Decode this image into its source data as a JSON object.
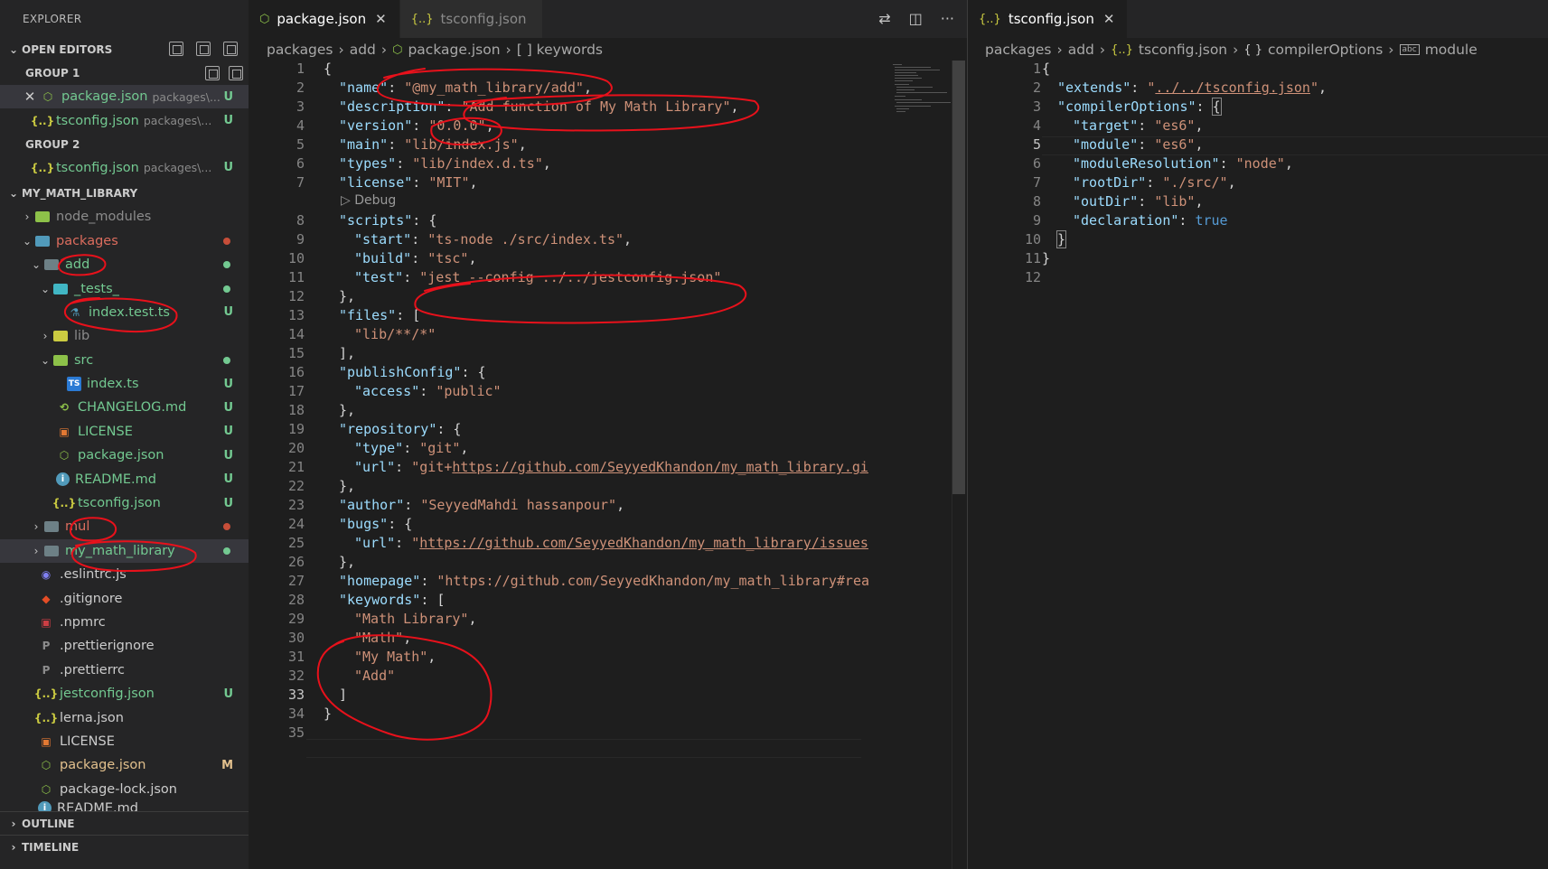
{
  "sidebar": {
    "title": "EXPLORER",
    "open_editors": {
      "label": "OPEN EDITORS",
      "group1_label": "GROUP 1",
      "group2_label": "GROUP 2",
      "group1": [
        {
          "name": "package.json",
          "path": "packages\\...",
          "badge": "U"
        },
        {
          "name": "tsconfig.json",
          "path": "packages\\...",
          "badge": "U"
        }
      ],
      "group2": [
        {
          "name": "tsconfig.json",
          "path": "packages\\...",
          "badge": "U"
        }
      ]
    },
    "workspace_label": "MY_MATH_LIBRARY",
    "tree": {
      "node_modules": "node_modules",
      "packages": "packages",
      "add": "add",
      "tests": "_tests_",
      "index_test": "index.test.ts",
      "lib": "lib",
      "src": "src",
      "index_ts": "index.ts",
      "changelog": "CHANGELOG.md",
      "license_inner": "LICENSE",
      "package_inner": "package.json",
      "readme_inner": "README.md",
      "tsconfig_inner": "tsconfig.json",
      "mul": "mul",
      "my_math_library": "my_math_library",
      "eslintrc": ".eslintrc.js",
      "gitignore": ".gitignore",
      "npmrc": ".npmrc",
      "prettierignore": ".prettierignore",
      "prettierrc": ".prettierrc",
      "jestconfig": "jestconfig.json",
      "lerna": "lerna.json",
      "license_root": "LICENSE",
      "package_root": "package.json",
      "package_lock": "package-lock.json",
      "readme_root": "README.md"
    },
    "badges": {
      "untracked": "U",
      "modified": "M"
    },
    "outline_label": "OUTLINE",
    "timeline_label": "TIMELINE"
  },
  "editor1": {
    "tabs": [
      {
        "label": "package.json",
        "icon": "npm-icon"
      },
      {
        "label": "tsconfig.json",
        "icon": "json-icon"
      }
    ],
    "breadcrumb": [
      "packages",
      "add",
      "package.json",
      "[ ] keywords"
    ],
    "codelens": "Debug",
    "lines": [
      {
        "n": "1"
      },
      {
        "n": "2"
      },
      {
        "n": "3"
      },
      {
        "n": "4"
      },
      {
        "n": "5"
      },
      {
        "n": "6"
      },
      {
        "n": "7"
      },
      {
        "n": "8"
      },
      {
        "n": "9"
      },
      {
        "n": "10"
      },
      {
        "n": "11"
      },
      {
        "n": "12"
      },
      {
        "n": "13"
      },
      {
        "n": "14"
      },
      {
        "n": "15"
      },
      {
        "n": "16"
      },
      {
        "n": "17"
      },
      {
        "n": "18"
      },
      {
        "n": "19"
      },
      {
        "n": "20"
      },
      {
        "n": "21"
      },
      {
        "n": "22"
      },
      {
        "n": "23"
      },
      {
        "n": "24"
      },
      {
        "n": "25"
      },
      {
        "n": "26"
      },
      {
        "n": "27"
      },
      {
        "n": "28"
      },
      {
        "n": "29"
      },
      {
        "n": "30"
      },
      {
        "n": "31"
      },
      {
        "n": "32"
      },
      {
        "n": "33"
      },
      {
        "n": "34"
      },
      {
        "n": "35"
      }
    ],
    "code": {
      "l1": "{",
      "name_k": "\"name\"",
      "name_v": "\"@my_math_library/add\"",
      "desc_k": "\"description\"",
      "desc_v": "\"Add function of My Math Library\"",
      "ver_k": "\"version\"",
      "ver_v": "\"0.0.0\"",
      "main_k": "\"main\"",
      "main_v": "\"lib/index.js\"",
      "types_k": "\"types\"",
      "types_v": "\"lib/index.d.ts\"",
      "lic_k": "\"license\"",
      "lic_v": "\"MIT\"",
      "scripts_k": "\"scripts\"",
      "start_k": "\"start\"",
      "start_v": "\"ts-node ./src/index.ts\"",
      "build_k": "\"build\"",
      "build_v": "\"tsc\"",
      "test_k": "\"test\"",
      "test_v": "\"jest --config ../../jestconfig.json\"",
      "files_k": "\"files\"",
      "files_v": "\"lib/**/*\"",
      "pub_k": "\"publishConfig\"",
      "access_k": "\"access\"",
      "access_v": "\"public\"",
      "repo_k": "\"repository\"",
      "type_k": "\"type\"",
      "type_v": "\"git\"",
      "url_k": "\"url\"",
      "url_q": "\"git+",
      "url_v": "https://github.com/SeyyedKhandon/my_math_library.gi",
      "author_k": "\"author\"",
      "author_v": "\"SeyyedMahdi hassanpour\"",
      "bugs_k": "\"bugs\"",
      "bugs_url_k": "\"url\"",
      "bugs_url_v": "https://github.com/SeyyedKhandon/my_math_library/issues",
      "home_k": "\"homepage\"",
      "home_v": "\"https://github.com/SeyyedKhandon/my_math_library#rea",
      "kw_k": "\"keywords\"",
      "kw1": "\"Math Library\"",
      "kw2": "\"Math\"",
      "kw3": "\"My Math\"",
      "kw4": "\"Add\""
    }
  },
  "editor2": {
    "tab": {
      "label": "tsconfig.json",
      "icon": "json-icon"
    },
    "breadcrumb": [
      "packages",
      "add",
      "tsconfig.json",
      "compilerOptions",
      "module"
    ],
    "lines": [
      {
        "n": "1"
      },
      {
        "n": "2"
      },
      {
        "n": "3"
      },
      {
        "n": "4"
      },
      {
        "n": "5"
      },
      {
        "n": "6"
      },
      {
        "n": "7"
      },
      {
        "n": "8"
      },
      {
        "n": "9"
      },
      {
        "n": "10"
      },
      {
        "n": "11"
      },
      {
        "n": "12"
      }
    ],
    "code": {
      "ext_k": "\"extends\"",
      "ext_v": "../../tsconfig.json",
      "co_k": "\"compilerOptions\"",
      "target_k": "\"target\"",
      "target_v": "\"es6\"",
      "module_k": "\"module\"",
      "module_v": "\"es6\"",
      "mr_k": "\"moduleResolution\"",
      "mr_v": "\"node\"",
      "root_k": "\"rootDir\"",
      "root_v": "\"./src/\"",
      "out_k": "\"outDir\"",
      "out_v": "\"lib\"",
      "decl_k": "\"declaration\"",
      "decl_v": "true"
    }
  },
  "colors": {
    "annotation": "#e8111b",
    "accent_green": "#73c991",
    "git_untracked": "#73c991",
    "git_modified": "#e2c08d",
    "dot_red": "#c74e39",
    "json_brace": "#cbcb41",
    "npm_icon": "#8dc149"
  }
}
